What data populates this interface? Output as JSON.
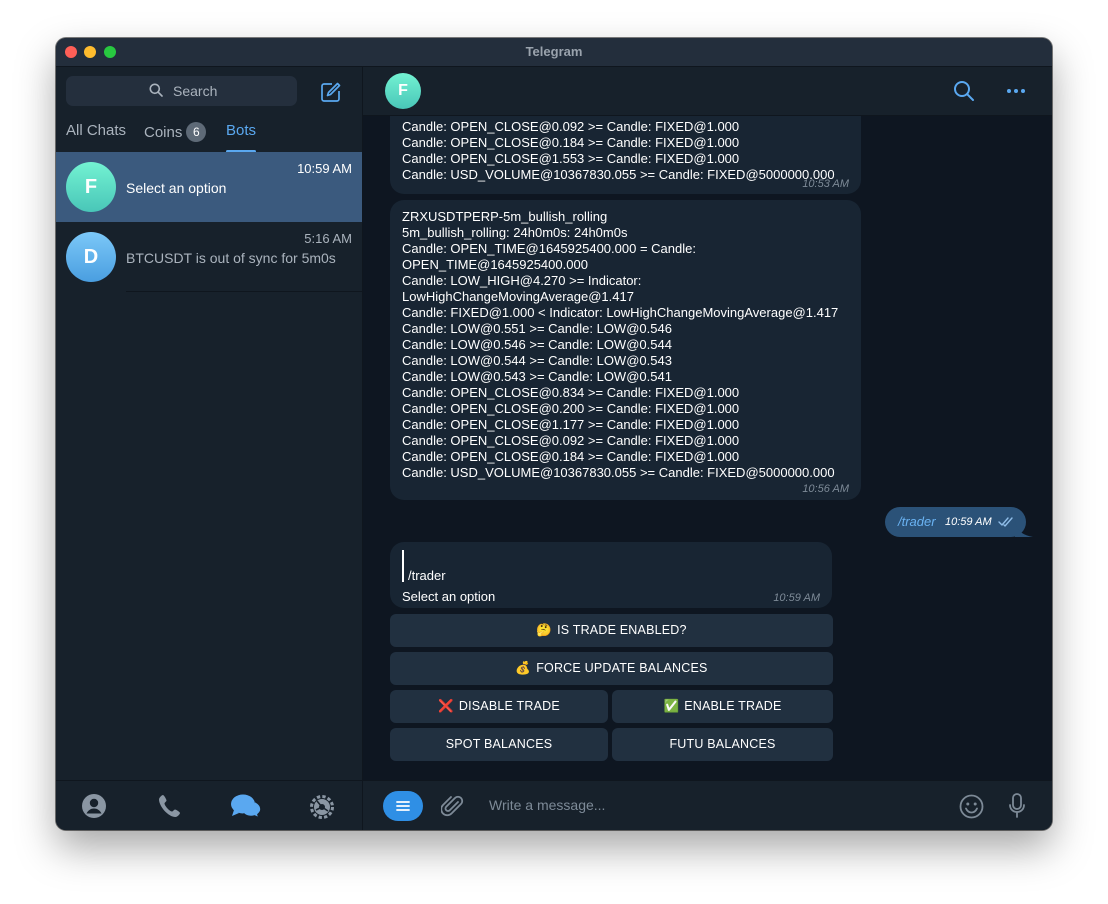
{
  "window": {
    "title": "Telegram"
  },
  "sidebar": {
    "search_placeholder": "Search",
    "tabs": [
      {
        "label": "All Chats"
      },
      {
        "label": "Coins",
        "badge": "6"
      },
      {
        "label": "Bots",
        "active": true
      }
    ],
    "chats": [
      {
        "initial": "F",
        "time": "10:59 AM",
        "preview": "Select an option",
        "selected": true
      },
      {
        "initial": "D",
        "time": "5:16 AM",
        "preview": "BTCUSDT is out of sync for 5m0s",
        "selected": false
      }
    ],
    "nav_icons": [
      "contacts-icon",
      "calls-icon",
      "chats-icon",
      "settings-icon"
    ]
  },
  "header": {
    "initial": "F"
  },
  "messages": {
    "msg1": {
      "lines": [
        "Candle: OPEN_CLOSE@0.092 >= Candle: FIXED@1.000",
        "Candle: OPEN_CLOSE@0.184 >= Candle: FIXED@1.000",
        "Candle: OPEN_CLOSE@1.553 >= Candle: FIXED@1.000",
        "Candle: USD_VOLUME@10367830.055 >= Candle: FIXED@5000000.000"
      ],
      "time": "10:53 AM"
    },
    "msg2": {
      "lines": [
        "ZRXUSDTPERP-5m_bullish_rolling",
        "5m_bullish_rolling: 24h0m0s: 24h0m0s",
        "Candle: OPEN_TIME@1645925400.000 = Candle:",
        "OPEN_TIME@1645925400.000",
        "Candle: LOW_HIGH@4.270 >= Indicator:",
        "LowHighChangeMovingAverage@1.417",
        "Candle: FIXED@1.000 < Indicator: LowHighChangeMovingAverage@1.417",
        "Candle: LOW@0.551 >= Candle: LOW@0.546",
        "Candle: LOW@0.546 >= Candle: LOW@0.544",
        "Candle: LOW@0.544 >= Candle: LOW@0.543",
        "Candle: LOW@0.543 >= Candle: LOW@0.541",
        "Candle: OPEN_CLOSE@0.834 >= Candle: FIXED@1.000",
        "Candle: OPEN_CLOSE@0.200 >= Candle: FIXED@1.000",
        "Candle: OPEN_CLOSE@1.177 >= Candle: FIXED@1.000",
        "Candle: OPEN_CLOSE@0.092 >= Candle: FIXED@1.000",
        "Candle: OPEN_CLOSE@0.184 >= Candle: FIXED@1.000",
        "Candle: USD_VOLUME@10367830.055 >= Candle: FIXED@5000000.000"
      ],
      "time": "10:56 AM"
    },
    "outgoing": {
      "text": "/trader",
      "time": "10:59 AM"
    },
    "reply": {
      "quote": "/trader",
      "text": "Select an option",
      "time": "10:59 AM"
    }
  },
  "keyboard": {
    "is_trade_enabled": {
      "emoji": "🤔",
      "label": "IS TRADE ENABLED?"
    },
    "force_update": {
      "emoji": "💰",
      "label": "FORCE UPDATE BALANCES"
    },
    "disable_trade": {
      "emoji": "❌",
      "label": "DISABLE TRADE"
    },
    "enable_trade": {
      "emoji": "✅",
      "label": "ENABLE TRADE"
    },
    "spot_balances": {
      "label": "SPOT BALANCES"
    },
    "futu_balances": {
      "label": "FUTU BALANCES"
    }
  },
  "composer": {
    "placeholder": "Write a message..."
  },
  "colors": {
    "accent": "#5aa8f0",
    "selected_chat": "#3b5a7e",
    "incoming_bubble": "#182533",
    "outgoing_bubble": "#2b5278"
  }
}
